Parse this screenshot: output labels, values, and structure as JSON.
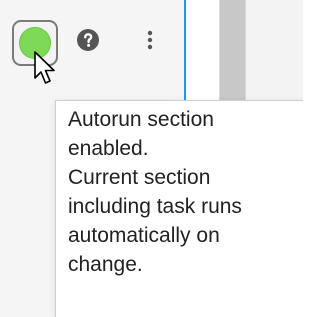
{
  "toolbar": {
    "autorun_button": {
      "state": "enabled",
      "indicator_color": "#7ed957"
    },
    "help_icon": "help-icon",
    "more_icon": "more-vertical-icon"
  },
  "tooltip": {
    "lines": [
      "Autorun section",
      "enabled.",
      "Current section",
      "including task runs",
      "automatically on",
      "change."
    ]
  },
  "colors": {
    "accent_divider": "#2196f3",
    "scrollbar": "#c8c8c8",
    "background": "#f5f5f5"
  }
}
